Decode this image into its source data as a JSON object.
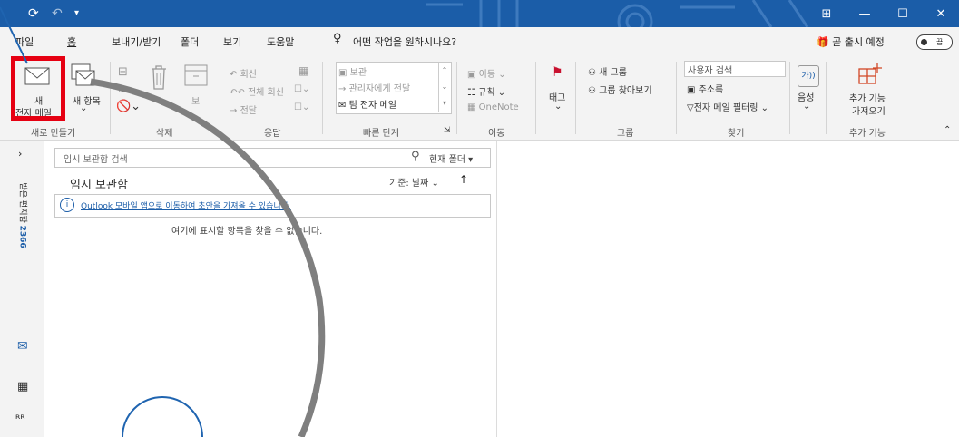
{
  "titlebar": {
    "icons": [
      "sync-icon",
      "undo-icon",
      "customize-icon"
    ],
    "controls": [
      "ribbon-display-icon",
      "minimize-icon",
      "maximize-icon",
      "close-icon"
    ]
  },
  "menu": {
    "items": [
      "파일",
      "홈",
      "보내기/받기",
      "폴더",
      "보기",
      "도움말"
    ],
    "tell_me": "어떤 작업을 원하시나요?",
    "coming_soon": "곧 출시 예정",
    "toggle_label": "끔"
  },
  "ribbon": {
    "new": {
      "new_email_line1": "새",
      "new_email_line2": "전자 메일",
      "new_items": "새 항목",
      "group": "새로 만들기"
    },
    "delete": {
      "group": "삭제",
      "archive": "보"
    },
    "respond": {
      "reply": "회신",
      "reply_all": "전체 회신",
      "forward": "전달",
      "group": "응답"
    },
    "quick_steps": {
      "items": [
        "보관",
        "관리자에게 전달",
        "팀 전자 메일"
      ],
      "group": "빠른 단계"
    },
    "move": {
      "move": "이동",
      "rules": "규칙",
      "onenote": "OneNote",
      "group": "이동"
    },
    "tags": {
      "tag": "태그"
    },
    "groups": {
      "new_group": "새 그룹",
      "browse_groups": "그룹 찾아보기",
      "group": "그룹"
    },
    "find": {
      "search_people": "사용자 검색",
      "address_book": "주소록",
      "filter_email": "전자 메일 필터링",
      "group": "찾기"
    },
    "voice": {
      "label": "음성"
    },
    "addins": {
      "label_line1": "추가 기능",
      "label_line2": "가져오기",
      "group": "추가 기능"
    }
  },
  "navpane": {
    "folder_label": "받은 편지함",
    "count": "2366"
  },
  "list": {
    "search_placeholder": "임시 보관함 검색",
    "scope": "현재 폴더",
    "folder_title": "임시 보관함",
    "sort_label": "기준: 날짜",
    "info_text": "Outlook 모바일 앱으로 이동하여 초안을 가져올 수 있습니다.",
    "empty_text": "여기에 표시할 항목을 찾을 수 없습니다."
  },
  "colors": {
    "titlebar": "#1b5da8",
    "highlight": "#e60012",
    "annotation_stroke": "#7f7f7f",
    "annotation_circle": "#1f64b0"
  }
}
